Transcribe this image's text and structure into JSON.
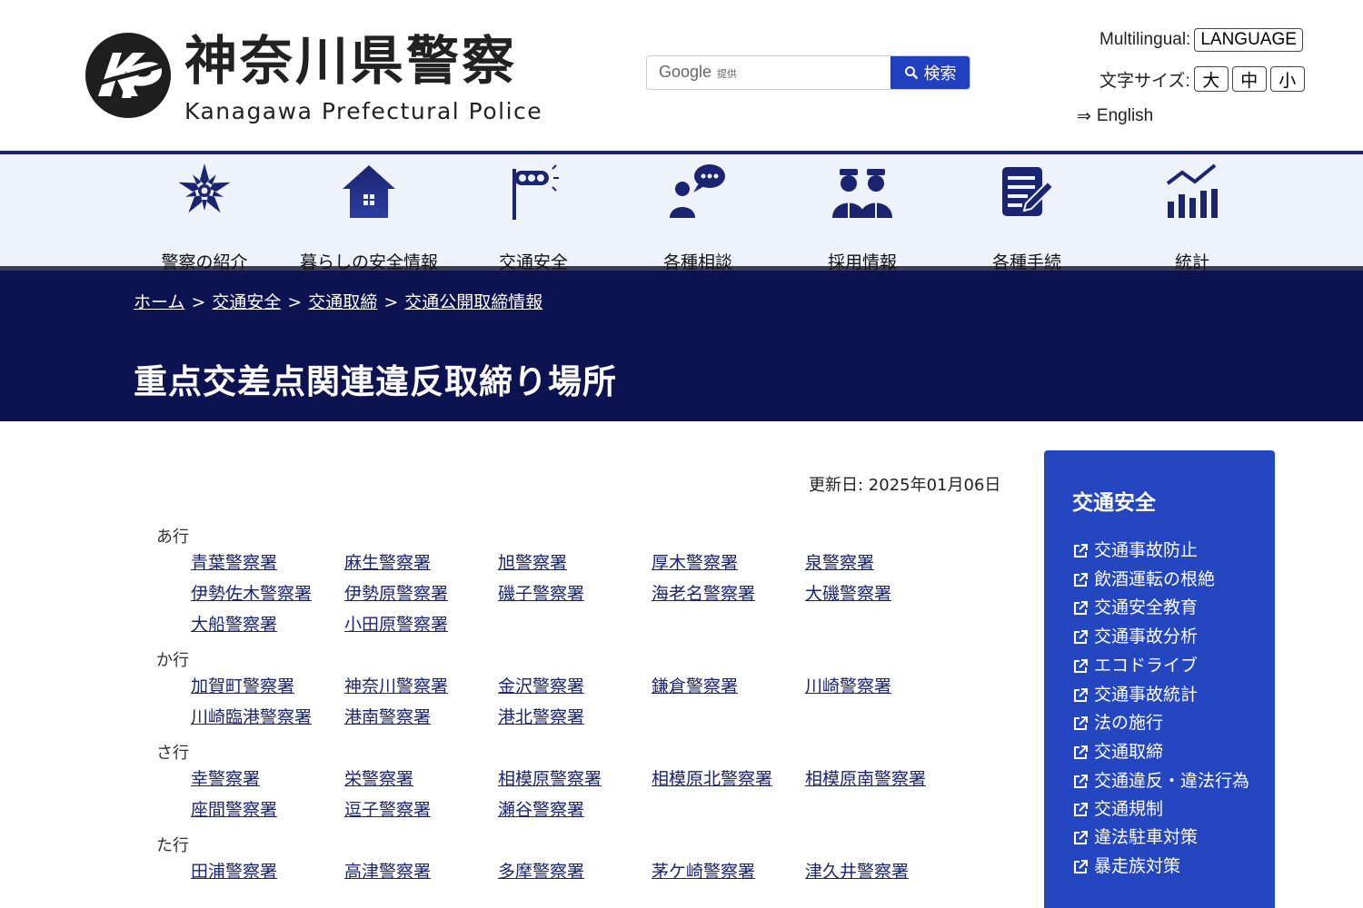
{
  "header": {
    "site_title": "神奈川県警察",
    "site_subtitle": "Kanagawa Prefectural Police",
    "logo_text": "KP"
  },
  "search": {
    "google_label": "Google",
    "google_sub": "提供",
    "button_label": "検索",
    "button_icon": "search-icon"
  },
  "utility": {
    "multilingual_label": "Multilingual:",
    "language_button": "LANGUAGE",
    "font_size_label": "文字サイズ:",
    "size_large": "大",
    "size_medium": "中",
    "size_small": "小",
    "english_arrow": "⇒",
    "english_link": "English"
  },
  "nav": {
    "items": [
      {
        "label": "警察の紹介",
        "icon": "police-emblem-icon"
      },
      {
        "label": "暮らしの安全情報",
        "icon": "house-icon"
      },
      {
        "label": "交通安全",
        "icon": "traffic-signal-icon"
      },
      {
        "label": "各種相談",
        "icon": "consultation-icon"
      },
      {
        "label": "採用情報",
        "icon": "officers-icon"
      },
      {
        "label": "各種手続",
        "icon": "form-edit-icon"
      },
      {
        "label": "統計",
        "icon": "bar-chart-icon"
      }
    ]
  },
  "breadcrumb": {
    "items": [
      "ホーム",
      "交通安全",
      "交通取締",
      "交通公開取締情報"
    ],
    "separator": ">"
  },
  "page": {
    "title": "重点交差点関連違反取締り場所",
    "updated": "更新日: 2025年01月06日"
  },
  "station_groups": [
    {
      "label": "あ行",
      "stations": [
        "青葉警察署",
        "麻生警察署",
        "旭警察署",
        "厚木警察署",
        "泉警察署",
        "伊勢佐木警察署",
        "伊勢原警察署",
        "磯子警察署",
        "海老名警察署",
        "大磯警察署",
        "大船警察署",
        "小田原警察署"
      ]
    },
    {
      "label": "か行",
      "stations": [
        "加賀町警察署",
        "神奈川警察署",
        "金沢警察署",
        "鎌倉警察署",
        "川崎警察署",
        "川崎臨港警察署",
        "港南警察署",
        "港北警察署"
      ]
    },
    {
      "label": "さ行",
      "stations": [
        "幸警察署",
        "栄警察署",
        "相模原警察署",
        "相模原北警察署",
        "相模原南警察署",
        "座間警察署",
        "逗子警察署",
        "瀬谷警察署"
      ]
    },
    {
      "label": "た行",
      "stations": [
        "田浦警察署",
        "高津警察署",
        "多摩警察署",
        "茅ケ崎警察署",
        "津久井警察署"
      ]
    }
  ],
  "sidebar": {
    "title": "交通安全",
    "items": [
      "交通事故防止",
      "飲酒運転の根絶",
      "交通安全教育",
      "交通事故分析",
      "エコドライブ",
      "交通事故統計",
      "法の施行",
      "交通取締",
      "交通違反・違法行為",
      "交通規制",
      "違法駐車対策",
      "暴走族対策"
    ],
    "item_icon": "external-link-icon"
  },
  "colors": {
    "nav_bg": "#eef2fb",
    "nav_icon": "#1b2470",
    "banner_bg": "#0d1250",
    "link": "#1b2470",
    "sidebar_bg": "#2446c0",
    "search_button": "#2040c0"
  }
}
